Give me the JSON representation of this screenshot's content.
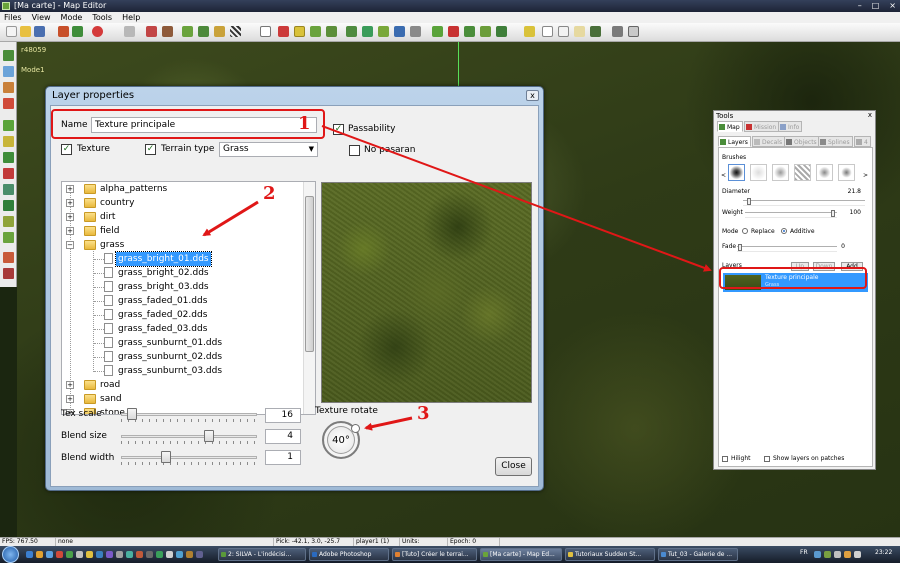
{
  "window": {
    "title": "[Ma carte] - Map Editor",
    "minimize": "–",
    "maximize": "□",
    "close": "×"
  },
  "menu": [
    "Files",
    "View",
    "Mode",
    "Tools",
    "Help"
  ],
  "viewport": {
    "line1": "r48059",
    "line2": "Mode1"
  },
  "dialog": {
    "title": "Layer properties",
    "close": "x",
    "name_label": "Name",
    "name_value": "Texture principale",
    "passability": "Passability",
    "no_pasaran": "No pasaran",
    "texture": "Texture",
    "terrain_type": "Terrain type",
    "terrain_value": "Grass",
    "folders_top": [
      "alpha_patterns",
      "country",
      "dirt",
      "field",
      "grass"
    ],
    "files": [
      "grass_bright_01.dds",
      "grass_bright_02.dds",
      "grass_bright_03.dds",
      "grass_faded_01.dds",
      "grass_faded_02.dds",
      "grass_faded_03.dds",
      "grass_sunburnt_01.dds",
      "grass_sunburnt_02.dds",
      "grass_sunburnt_03.dds"
    ],
    "folders_bottom": [
      "road",
      "sand",
      "stone"
    ],
    "tex_scale_label": "Tex scale",
    "tex_scale_value": "16",
    "tex_scale_fraction": 0.05,
    "blend_size_label": "Blend size",
    "blend_size_value": "4",
    "blend_size_fraction": 0.66,
    "blend_width_label": "Blend width",
    "blend_width_value": "1",
    "blend_width_fraction": 0.32,
    "texture_rotate_label": "Texture rotate",
    "texture_rotate_value": "40°",
    "close_button": "Close"
  },
  "tools": {
    "title": "Tools",
    "close": "x",
    "tabs_top": [
      "Map",
      "Mission",
      "Info"
    ],
    "tabs_bottom": [
      "Layers",
      "Decals",
      "Objects",
      "Splines",
      "4"
    ],
    "brushes_label": "Brushes",
    "brush_prev": "<",
    "brush_next": ">",
    "diameter_label": "Diameter",
    "diameter_value": "21.8",
    "weight_label": "Weight",
    "weight_value": "100",
    "mode_label": "Mode",
    "mode_replace": "Replace",
    "mode_additive": "Additive",
    "fade_label": "Fade",
    "fade_value": "0",
    "layers_label": "Layers",
    "up_button": "Up",
    "down_button": "Down",
    "add_button": "Add",
    "layer_name": "Texture principale",
    "layer_sub": "Grass",
    "hilight": "Hilight",
    "show_layers": "Show layers on patches"
  },
  "status": {
    "fps": "FPS: 767.50",
    "mode": "none",
    "pick": "Pick: -42.1, 3.0, -25.7",
    "player": "player1 (1)",
    "units": "Units:",
    "epoch": "Epoch: 0"
  },
  "taskbar": {
    "tasks": [
      "2: SILVA - L'indécisi...",
      "Adobe Photoshop",
      "[Tuto] Créer le terrai...",
      "[Ma carte] - Map Ed...",
      "Tutoriaux Sudden St...",
      "Tut_03 - Galerie de ..."
    ],
    "lang": "FR",
    "time": "23:22"
  },
  "annotations": {
    "n1": "1",
    "n2": "2",
    "n3": "3"
  }
}
